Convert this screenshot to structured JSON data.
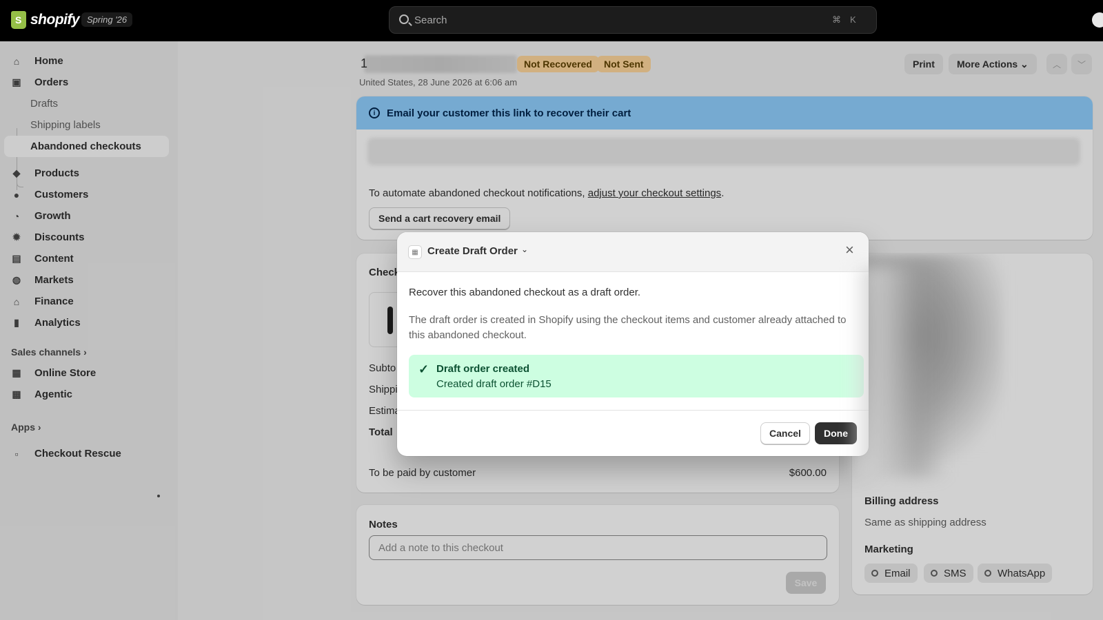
{
  "topbar": {
    "brand": "shopify",
    "edition": "Spring '26",
    "search_placeholder": "Search",
    "shortcut_cmd": "⌘",
    "shortcut_key": "K"
  },
  "sidebar": {
    "items": [
      {
        "label": "Home",
        "icon": "home-icon"
      },
      {
        "label": "Orders",
        "icon": "orders-icon"
      },
      {
        "label": "Products",
        "icon": "tag-icon"
      },
      {
        "label": "Customers",
        "icon": "person-icon"
      },
      {
        "label": "Growth",
        "icon": "growth-icon"
      },
      {
        "label": "Discounts",
        "icon": "discount-icon"
      },
      {
        "label": "Content",
        "icon": "content-icon"
      },
      {
        "label": "Markets",
        "icon": "globe-icon"
      },
      {
        "label": "Finance",
        "icon": "bank-icon"
      },
      {
        "label": "Analytics",
        "icon": "bar-chart-icon"
      }
    ],
    "orders_sub": [
      "Drafts",
      "Shipping labels",
      "Abandoned checkouts"
    ],
    "sales_channels_title": "Sales channels",
    "sales_channels": [
      {
        "label": "Online Store",
        "icon": "store-icon"
      },
      {
        "label": "Agentic",
        "icon": "agent-icon"
      }
    ],
    "apps_title": "Apps",
    "apps": [
      {
        "label": "Checkout Rescue",
        "icon": "app-icon"
      }
    ]
  },
  "header": {
    "title_char": "1",
    "badges": [
      "Not Recovered",
      "Not Sent"
    ],
    "subline": "United States, 28 June 2026 at 6:06 am",
    "print_label": "Print",
    "more_actions_label": "More Actions"
  },
  "recovery": {
    "banner": "Email your customer this link to recover their cart",
    "automate_text": "To automate abandoned checkout notifications,",
    "automate_link": "adjust your checkout settings",
    "automate_end": ".",
    "send_button": "Send a cart recovery email"
  },
  "checkout": {
    "title_partial": "Check",
    "rows": [
      "Subto",
      "Shippi",
      "Estima",
      "Total"
    ],
    "to_be_paid_label": "To be paid by customer",
    "to_be_paid_value": "$600.00"
  },
  "notes": {
    "title": "Notes",
    "placeholder": "Add a note to this checkout",
    "save_label": "Save"
  },
  "customer_panel": {
    "billing_title": "Billing address",
    "billing_text": "Same as shipping address",
    "marketing_title": "Marketing",
    "channels": [
      "Email",
      "SMS",
      "WhatsApp"
    ]
  },
  "modal": {
    "title": "Create Draft Order",
    "intro": "Recover this abandoned checkout as a draft order.",
    "description": "The draft order is created in Shopify using the checkout items and customer already attached to this abandoned checkout.",
    "success_title": "Draft order created",
    "success_message": "Created draft order #D15",
    "cancel_label": "Cancel",
    "done_label": "Done"
  }
}
